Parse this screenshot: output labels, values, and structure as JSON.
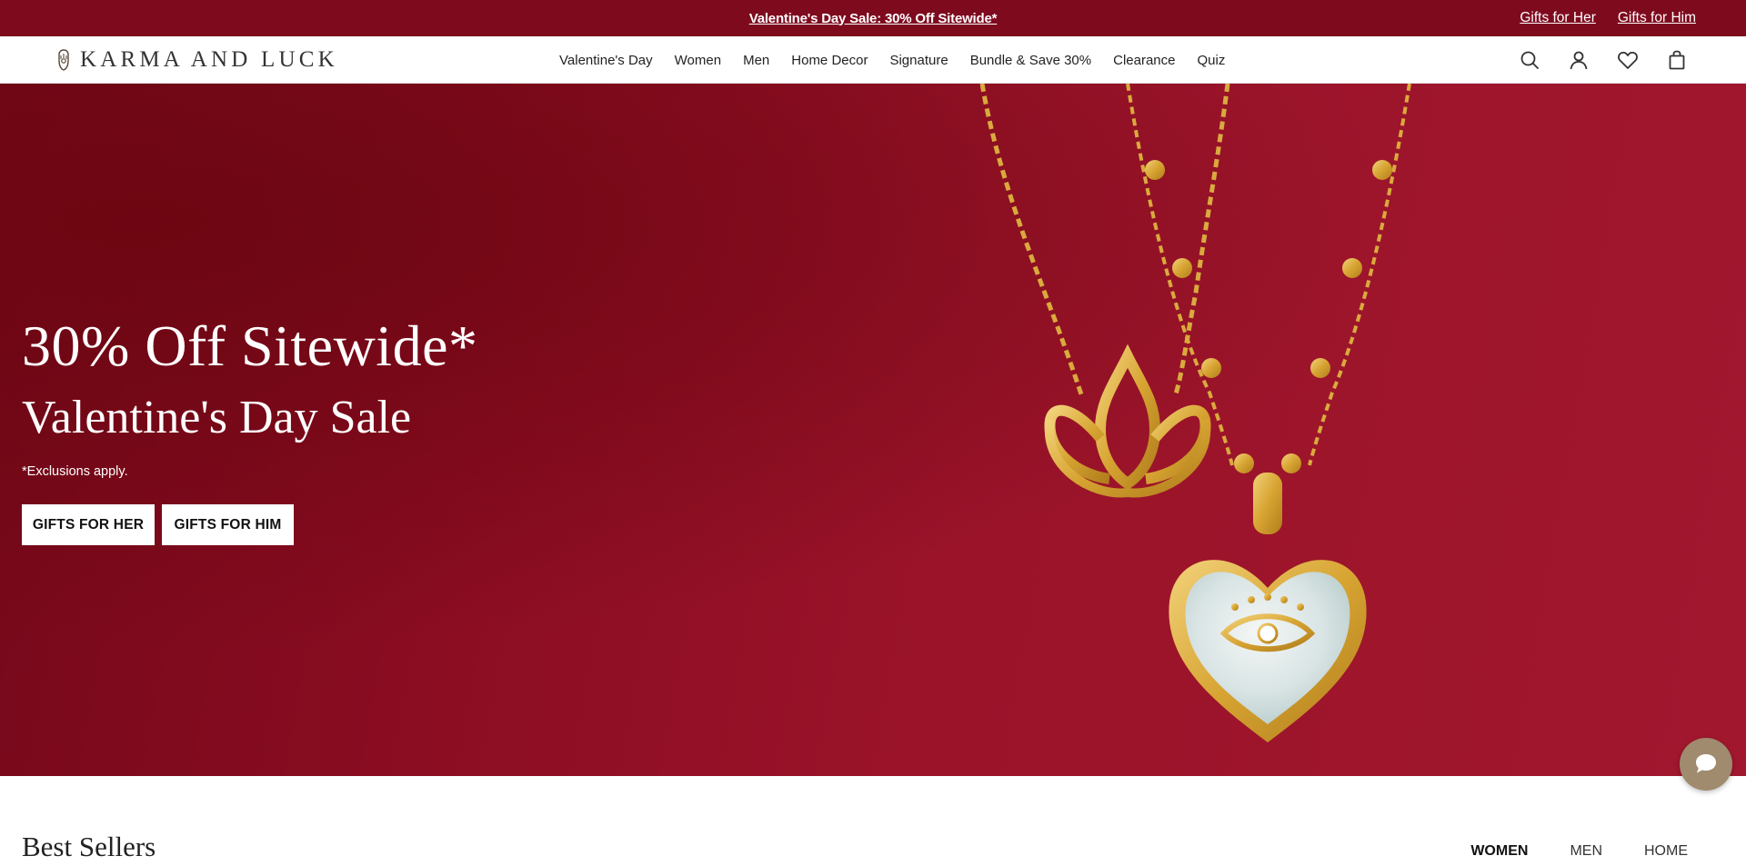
{
  "announcement": {
    "center_text": "Valentine's Day Sale: 30% Off Sitewide*",
    "links": [
      "Gifts for Her",
      "Gifts for Him"
    ]
  },
  "header": {
    "logo_text": "KARMA AND LUCK",
    "nav": [
      "Valentine's Day",
      "Women",
      "Men",
      "Home Decor",
      "Signature",
      "Bundle & Save 30%",
      "Clearance",
      "Quiz"
    ],
    "icons": [
      "search-icon",
      "account-icon",
      "heart-icon",
      "bag-icon"
    ]
  },
  "hero": {
    "title": "30% Off Sitewide*",
    "subtitle": "Valentine's Day Sale",
    "note": "*Exclusions apply.",
    "buttons": [
      "GIFTS FOR HER",
      "GIFTS FOR HIM"
    ]
  },
  "best_sellers": {
    "title": "Best Sellers",
    "tabs": [
      "WOMEN",
      "MEN",
      "HOME"
    ],
    "active_tab": "WOMEN"
  },
  "colors": {
    "announcement_bg": "#7e0a1e",
    "hero_bg": "#9a1329",
    "gold": "#d8a93a",
    "chat_bg": "#a08b6f"
  }
}
